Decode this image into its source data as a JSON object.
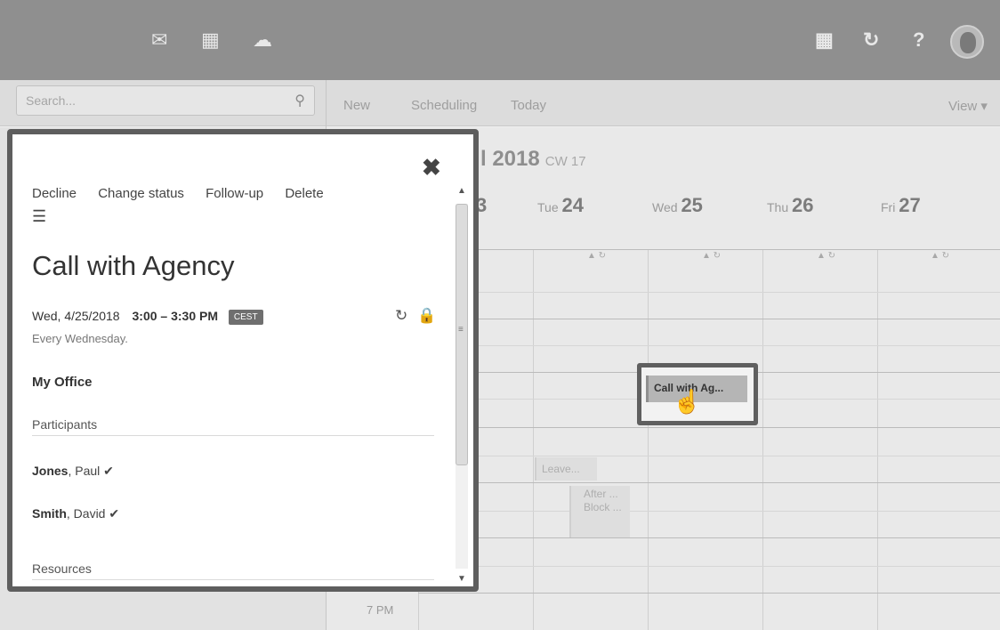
{
  "topbar": {
    "icons": [
      "mail-icon",
      "calendar-icon",
      "cloud-icon",
      "apps-grid-icon",
      "refresh-icon",
      "help-icon"
    ],
    "help_label": "?"
  },
  "search": {
    "placeholder": "Search..."
  },
  "toolbar": {
    "new_label": "New",
    "scheduling_label": "Scheduling",
    "today_label": "Today",
    "view_label": "View ▾"
  },
  "calendar": {
    "title_partial": "l 2018",
    "cw": "CW 17",
    "days": [
      {
        "prefix": "",
        "num": "3"
      },
      {
        "prefix": "Tue",
        "num": "24"
      },
      {
        "prefix": "Wed",
        "num": "25"
      },
      {
        "prefix": "Thu",
        "num": "26"
      },
      {
        "prefix": "Fri",
        "num": "27"
      }
    ],
    "hour_label": "7 PM",
    "events": {
      "call": "Call with Ag...",
      "leave": "Leave...",
      "after": "After ...",
      "block": "Block ..."
    }
  },
  "popup": {
    "actions": {
      "decline": "Decline",
      "change_status": "Change status",
      "follow_up": "Follow-up",
      "delete": "Delete"
    },
    "title": "Call with Agency",
    "date": "Wed, 4/25/2018",
    "time": "3:00 – 3:30 PM",
    "timezone": "CEST",
    "recurrence": "Every Wednesday.",
    "location": "My Office",
    "participants_label": "Participants",
    "participants": [
      {
        "last": "Jones",
        "first": ", Paul ✔"
      },
      {
        "last": "Smith",
        "first": ", David ✔"
      }
    ],
    "resources_label": "Resources"
  }
}
